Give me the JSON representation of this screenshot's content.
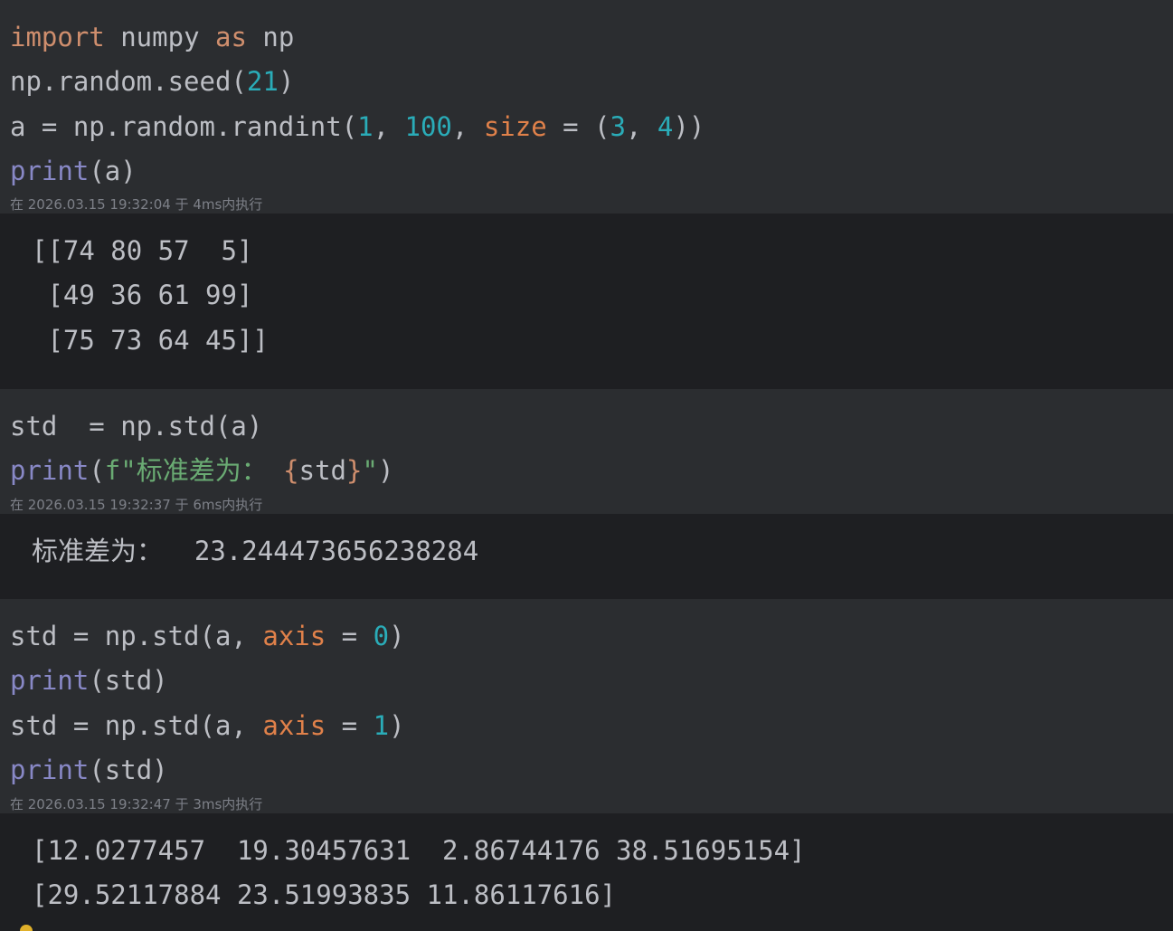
{
  "cells": [
    {
      "code": [
        [
          {
            "t": "import",
            "c": "kw"
          },
          {
            "t": " numpy "
          },
          {
            "t": "as",
            "c": "kw"
          },
          {
            "t": " np"
          }
        ],
        [
          {
            "t": "np.random.seed("
          },
          {
            "t": "21",
            "c": "num"
          },
          {
            "t": ")"
          }
        ],
        [
          {
            "t": "a = np.random.randint("
          },
          {
            "t": "1",
            "c": "num"
          },
          {
            "t": ", "
          },
          {
            "t": "100",
            "c": "num"
          },
          {
            "t": ", "
          },
          {
            "t": "size",
            "c": "param"
          },
          {
            "t": " = ("
          },
          {
            "t": "3",
            "c": "num"
          },
          {
            "t": ", "
          },
          {
            "t": "4",
            "c": "num"
          },
          {
            "t": "))"
          }
        ],
        [
          {
            "t": "print",
            "c": "fn"
          },
          {
            "t": "(a)"
          }
        ]
      ],
      "meta": "在 2026.03.15 19:32:04 于 4ms内执行",
      "output": [
        "[[74 80 57  5]",
        " [49 36 61 99]",
        " [75 73 64 45]]"
      ]
    },
    {
      "code": [
        [
          {
            "t": "std  = np.std(a)"
          }
        ],
        [
          {
            "t": "print",
            "c": "fn"
          },
          {
            "t": "("
          },
          {
            "t": "f\"标准差为： ",
            "c": "str"
          },
          {
            "t": "{",
            "c": "brace"
          },
          {
            "t": "std"
          },
          {
            "t": "}",
            "c": "brace"
          },
          {
            "t": "\"",
            "c": "str"
          },
          {
            "t": ")"
          }
        ]
      ],
      "meta": "在 2026.03.15 19:32:37 于 6ms内执行",
      "output": [
        "标准差为：  23.244473656238284"
      ]
    },
    {
      "code": [
        [
          {
            "t": "std = np.std(a, "
          },
          {
            "t": "axis",
            "c": "param"
          },
          {
            "t": " = "
          },
          {
            "t": "0",
            "c": "num"
          },
          {
            "t": ")"
          }
        ],
        [
          {
            "t": "print",
            "c": "fn"
          },
          {
            "t": "(std)"
          }
        ],
        [
          {
            "t": "std = np.std(a, "
          },
          {
            "t": "axis",
            "c": "param"
          },
          {
            "t": " = "
          },
          {
            "t": "1",
            "c": "num"
          },
          {
            "t": ")"
          }
        ],
        [
          {
            "t": "print",
            "c": "fn"
          },
          {
            "t": "(std)"
          }
        ]
      ],
      "meta": "在 2026.03.15 19:32:47 于 3ms内执行",
      "output": [
        "[12.0277457  19.30457631  2.86744176 38.51695154]",
        "[29.52117884 23.51993835 11.86117616]"
      ]
    }
  ]
}
